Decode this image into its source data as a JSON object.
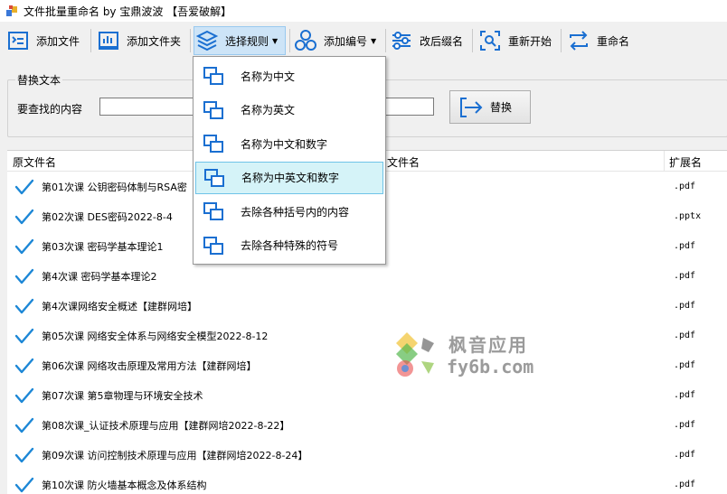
{
  "window": {
    "title": "文件批量重命名 by 宝鼎波波 【吾爱破解】"
  },
  "toolbar": {
    "add_file": "添加文件",
    "add_folder": "添加文件夹",
    "select_rule": "选择规则",
    "add_number": "添加编号",
    "change_ext": "改后缀名",
    "restart": "重新开始",
    "rename": "重命名"
  },
  "replace_group": {
    "legend": "替换文本",
    "find_label": "要查找的内容",
    "find_value": "",
    "replace_button": "替换"
  },
  "list": {
    "columns": {
      "original": "原文件名",
      "new_name": "文件名",
      "extension": "扩展名"
    },
    "rows": [
      {
        "name": "第01次课 公钥密码体制与RSA密",
        "ext": ".pdf"
      },
      {
        "name": "第02次课 DES密码2022-8-4",
        "ext": ".pptx"
      },
      {
        "name": "第03次课 密码学基本理论1",
        "ext": ".pdf"
      },
      {
        "name": "第4次课 密码学基本理论2",
        "ext": ".pdf"
      },
      {
        "name": "第4次课网络安全概述【建群网培】",
        "ext": ".pdf"
      },
      {
        "name": "第05次课 网络安全体系与网络安全模型2022-8-12",
        "ext": ".pdf"
      },
      {
        "name": "第06次课 网络攻击原理及常用方法【建群网培】",
        "ext": ".pdf"
      },
      {
        "name": "第07次课 第5章物理与环境安全技术",
        "ext": ".pdf"
      },
      {
        "name": "第08次课_认证技术原理与应用【建群网培2022-8-22】",
        "ext": ".pdf"
      },
      {
        "name": "第09次课 访问控制技术原理与应用【建群网培2022-8-24】",
        "ext": ".pdf"
      },
      {
        "name": "第10次课 防火墙基本概念及体系结构",
        "ext": ".pdf"
      }
    ]
  },
  "rule_menu": {
    "items": [
      {
        "label": "名称为中文"
      },
      {
        "label": "名称为英文"
      },
      {
        "label": "名称为中文和数字"
      },
      {
        "label": "名称为中英文和数字",
        "highlighted": true
      },
      {
        "label": "去除各种括号内的内容"
      },
      {
        "label": "去除各种特殊的符号"
      }
    ]
  },
  "watermark": {
    "line1": "枫音应用",
    "line2": "fy6b.com"
  },
  "colors": {
    "accent": "#1a6fd1",
    "check": "#1c87d6",
    "menu_hover": "#d5f3f8",
    "menu_hover_border": "#6fc3e8",
    "watermark": "#9b9b9b"
  }
}
